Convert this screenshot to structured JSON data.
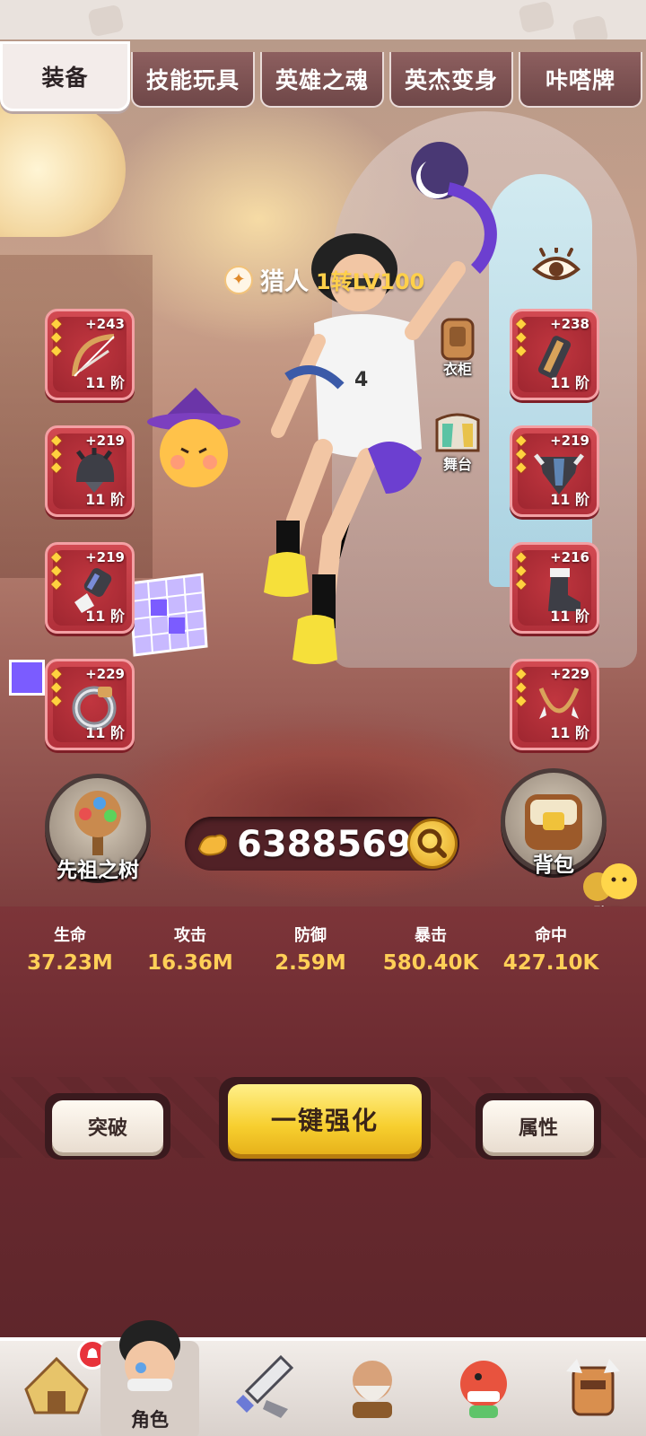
{
  "tabs": [
    {
      "label": "装备",
      "active": true
    },
    {
      "label": "技能玩具",
      "active": false
    },
    {
      "label": "英雄之魂",
      "active": false
    },
    {
      "label": "英杰变身",
      "active": false
    },
    {
      "label": "咔嗒牌",
      "active": false
    }
  ],
  "hero": {
    "class_name": "猎人",
    "level_text": "1转LV100",
    "class_icon": "claw-icon"
  },
  "equipment": {
    "left": [
      {
        "name": "bow",
        "plus": "+243",
        "tier": "11 阶",
        "stars": 3
      },
      {
        "name": "helmet",
        "plus": "+219",
        "tier": "11 阶",
        "stars": 3
      },
      {
        "name": "glove",
        "plus": "+219",
        "tier": "11 阶",
        "stars": 3
      },
      {
        "name": "ring",
        "plus": "+229",
        "tier": "11 阶",
        "stars": 3
      }
    ],
    "right": [
      {
        "name": "bracer",
        "plus": "+238",
        "tier": "11 阶",
        "stars": 3
      },
      {
        "name": "armor",
        "plus": "+219",
        "tier": "11 阶",
        "stars": 3
      },
      {
        "name": "boots",
        "plus": "+216",
        "tier": "11 阶",
        "stars": 3
      },
      {
        "name": "necklace",
        "plus": "+229",
        "tier": "11 阶",
        "stars": 3
      }
    ]
  },
  "side": {
    "wardrobe": "衣柜",
    "stage": "舞台"
  },
  "ancestor_tree": "先祖之树",
  "backpack": "背包",
  "power": "63885695",
  "chat": "聊天",
  "stats": [
    {
      "name": "生命",
      "value": "37.23M"
    },
    {
      "name": "攻击",
      "value": "16.36M"
    },
    {
      "name": "防御",
      "value": "2.59M"
    },
    {
      "name": "暴击",
      "value": "580.40K"
    },
    {
      "name": "命中",
      "value": "427.10K"
    }
  ],
  "actions": {
    "breakthrough": "突破",
    "one_click_enhance": "一键强化",
    "attributes": "属性"
  },
  "nav": [
    {
      "icon": "hut-icon",
      "label": "",
      "badge": true
    },
    {
      "icon": "character-icon",
      "label": "角色",
      "active": true
    },
    {
      "icon": "sword-icon",
      "label": ""
    },
    {
      "icon": "elder-icon",
      "label": ""
    },
    {
      "icon": "dino-icon",
      "label": ""
    },
    {
      "icon": "totem-icon",
      "label": ""
    }
  ],
  "colors": {
    "slot_red": "#c0343e",
    "gold_text": "#ffcf57",
    "level_yellow": "#ffd04a",
    "main_button": "#f7cf2f"
  }
}
